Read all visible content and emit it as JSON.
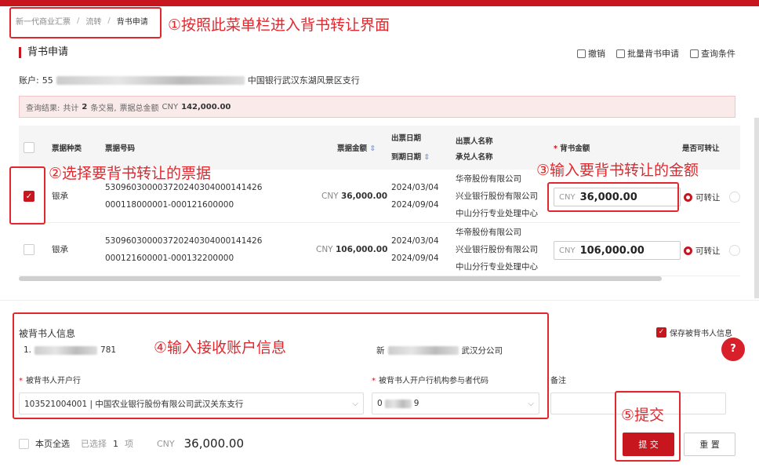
{
  "breadcrumb": [
    "新一代商业汇票",
    "流转",
    "背书申请"
  ],
  "breadcrumb_sep": "/",
  "annotations": {
    "a1": "①按照此菜单栏进入背书转让界面",
    "a2": "②选择要背书转让的票据",
    "a3": "③输入要背书转让的金额",
    "a4": "④输入接收账户信息",
    "a5": "⑤提交"
  },
  "panel_title": "背书申请",
  "actions": {
    "revoke": "撤销",
    "batch": "批量背书申请",
    "query": "查询条件"
  },
  "account": {
    "label": "账户:",
    "prefix": "55",
    "bank": "中国银行武汉东湖风景区支行"
  },
  "query_result": {
    "label": "查询结果:",
    "text_a": "共计",
    "count": "2",
    "text_b": "条交易,",
    "text_c": "票据总金额",
    "currency": "CNY",
    "total": "142,000.00"
  },
  "table": {
    "headers": {
      "type": "票据种类",
      "no": "票据号码",
      "amount": "票据金额",
      "issue_date": "出票日期",
      "due_date": "到期日期",
      "drawer": "出票人名称",
      "acceptor": "承兑人名称",
      "endorse_amount": "背书金额",
      "transferable": "是否可转让"
    },
    "rows": [
      {
        "type": "银承",
        "no1": "530960300003720240304000141426",
        "no2": "000118000001-000121600000",
        "amount_cny": "CNY",
        "amount": "36,000.00",
        "issue": "2024/03/04",
        "due": "2024/09/04",
        "drawer": "华帝股份有限公司",
        "acceptor": "兴业银行股份有限公司",
        "acceptor2": "中山分行专业处理中心",
        "endorse_cny": "CNY",
        "endorse": "36,000.00",
        "transfer": "可转让"
      },
      {
        "type": "银承",
        "no1": "530960300003720240304000141426",
        "no2": "000121600001-000132200000",
        "amount_cny": "CNY",
        "amount": "106,000.00",
        "issue": "2024/03/04",
        "due": "2024/09/04",
        "drawer": "华帝股份有限公司",
        "acceptor": "兴业银行股份有限公司",
        "acceptor2": "中山分行专业处理中心",
        "endorse_cny": "CNY",
        "endorse": "106,000.00",
        "transfer": "可转让"
      }
    ]
  },
  "endorsee": {
    "section": "被背书人信息",
    "account_prefix": "1.",
    "account_suffix": "781",
    "name_prefix": "新",
    "name_suffix": "武汉分公司",
    "bank_label": "被背书人开户行",
    "bank_value": "103521004001 | 中国农业银行股份有限公司武汉关东支行",
    "code_label": "被背书人开户行机构参与者代码",
    "code_prefix": "0",
    "code_suffix": "9",
    "remark_label": "备注",
    "save_label": "保存被背书人信息"
  },
  "help": "?",
  "footer": {
    "select_all": "本页全选",
    "selected": "已选择",
    "count": "1",
    "unit": "项",
    "currency": "CNY",
    "total": "36,000.00"
  },
  "buttons": {
    "submit": "提 交",
    "reset": "重 置"
  },
  "colors": {
    "brand": "#c8161e",
    "annotation": "#e0282e"
  }
}
